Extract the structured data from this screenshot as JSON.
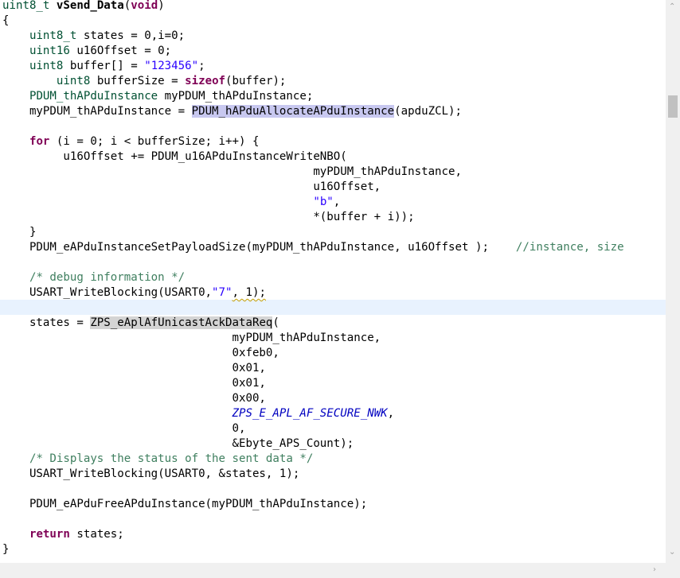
{
  "code_lines": [
    [
      {
        "t": "uint8_t",
        "c": "ty"
      },
      {
        "t": " "
      },
      {
        "t": "vSend_Data",
        "c": "fn"
      },
      {
        "t": "("
      },
      {
        "t": "void",
        "c": "kw"
      },
      {
        "t": ")"
      }
    ],
    [
      {
        "t": "{"
      }
    ],
    [
      {
        "t": "    "
      },
      {
        "t": "uint8_t",
        "c": "ty"
      },
      {
        "t": " states = 0,i=0;"
      }
    ],
    [
      {
        "t": "    "
      },
      {
        "t": "uint16",
        "c": "ty"
      },
      {
        "t": " u16Offset = 0;"
      }
    ],
    [
      {
        "t": "    "
      },
      {
        "t": "uint8",
        "c": "ty"
      },
      {
        "t": " buffer[] = "
      },
      {
        "t": "\"123456\"",
        "c": "str"
      },
      {
        "t": ";"
      }
    ],
    [
      {
        "t": "        "
      },
      {
        "t": "uint8",
        "c": "ty"
      },
      {
        "t": " bufferSize = "
      },
      {
        "t": "sizeof",
        "c": "kw"
      },
      {
        "t": "(buffer);"
      }
    ],
    [
      {
        "t": "    "
      },
      {
        "t": "PDUM_thAPduInstance",
        "c": "ty"
      },
      {
        "t": " myPDUM_thAPduInstance;"
      }
    ],
    [
      {
        "t": "    myPDUM_thAPduInstance = "
      },
      {
        "t": "PDUM_hAPduAllocateAPduInstance",
        "c": "sel"
      },
      {
        "t": "(apduZCL);"
      }
    ],
    [
      {
        "t": ""
      }
    ],
    [
      {
        "t": "    "
      },
      {
        "t": "for",
        "c": "kw"
      },
      {
        "t": " (i = 0; i < bufferSize; i++) {"
      }
    ],
    [
      {
        "t": "         u16Offset += PDUM_u16APduInstanceWriteNBO("
      }
    ],
    [
      {
        "t": "                                              myPDUM_thAPduInstance,"
      }
    ],
    [
      {
        "t": "                                              u16Offset,"
      }
    ],
    [
      {
        "t": "                                              "
      },
      {
        "t": "\"b\"",
        "c": "str"
      },
      {
        "t": ","
      }
    ],
    [
      {
        "t": "                                              *(buffer + i));"
      }
    ],
    [
      {
        "t": "    }"
      }
    ],
    [
      {
        "t": "    PDUM_eAPduInstanceSetPayloadSize(myPDUM_thAPduInstance, u16Offset );    "
      },
      {
        "t": "//instance, size",
        "c": "cm"
      }
    ],
    [
      {
        "t": ""
      }
    ],
    [
      {
        "t": "    "
      },
      {
        "t": "/* debug information */",
        "c": "cm"
      }
    ],
    [
      {
        "t": "    USART_WriteBlocking(USART0,"
      },
      {
        "t": "\"7\"",
        "c": "str"
      },
      {
        "t": ", 1);",
        "c": "squig"
      }
    ],
    [
      {
        "t": ""
      }
    ],
    [
      {
        "t": "    states = "
      },
      {
        "t": "ZPS_eAplAfUnicastAckDataReq",
        "c": "occ"
      },
      {
        "t": "("
      }
    ],
    [
      {
        "t": "                                  myPDUM_thAPduInstance,"
      }
    ],
    [
      {
        "t": "                                  0xfeb0,"
      }
    ],
    [
      {
        "t": "                                  0x01,"
      }
    ],
    [
      {
        "t": "                                  0x01,"
      }
    ],
    [
      {
        "t": "                                  0x00,"
      }
    ],
    [
      {
        "t": "                                  "
      },
      {
        "t": "ZPS_E_APL_AF_SECURE_NWK",
        "c": "mac"
      },
      {
        "t": ","
      }
    ],
    [
      {
        "t": "                                  0,"
      }
    ],
    [
      {
        "t": "                                  &Ebyte_APS_Count);"
      }
    ],
    [
      {
        "t": "    "
      },
      {
        "t": "/* Displays the status of the sent data */",
        "c": "cm"
      }
    ],
    [
      {
        "t": "    USART_WriteBlocking(USART0, &states, 1);"
      }
    ],
    [
      {
        "t": ""
      }
    ],
    [
      {
        "t": "    PDUM_eAPduFreeAPduInstance(myPDUM_thAPduInstance);"
      }
    ],
    [
      {
        "t": ""
      }
    ],
    [
      {
        "t": "    "
      },
      {
        "t": "return",
        "c": "kw"
      },
      {
        "t": " states;"
      }
    ],
    [
      {
        "t": "}"
      }
    ]
  ],
  "scrollbar": {
    "up_icon": "chevron-up-icon",
    "down_icon": "chevron-down-icon",
    "right_icon": "chevron-right-icon"
  }
}
